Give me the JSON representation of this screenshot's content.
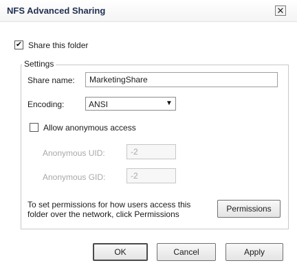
{
  "window": {
    "title": "NFS Advanced Sharing",
    "close_glyph": "✕"
  },
  "share_folder": {
    "label": "Share this folder",
    "checked": true,
    "check_glyph": "✔"
  },
  "settings": {
    "legend": "Settings",
    "share_name_label": "Share name:",
    "share_name_value": "MarketingShare",
    "encoding_label": "Encoding:",
    "encoding_value": "ANSI",
    "encoding_arrow": "▼",
    "allow_anonymous_label": "Allow anonymous access",
    "allow_anonymous_checked": false,
    "anonymous_uid_label": "Anonymous UID:",
    "anonymous_uid_value": "-2",
    "anonymous_gid_label": "Anonymous GID:",
    "anonymous_gid_value": "-2",
    "permissions_text_line1": "To set permissions for how users access this",
    "permissions_text_line2": "folder over the network, click Permissions",
    "permissions_button": "Permissions"
  },
  "buttons": {
    "ok": "OK",
    "cancel": "Cancel",
    "apply": "Apply"
  }
}
